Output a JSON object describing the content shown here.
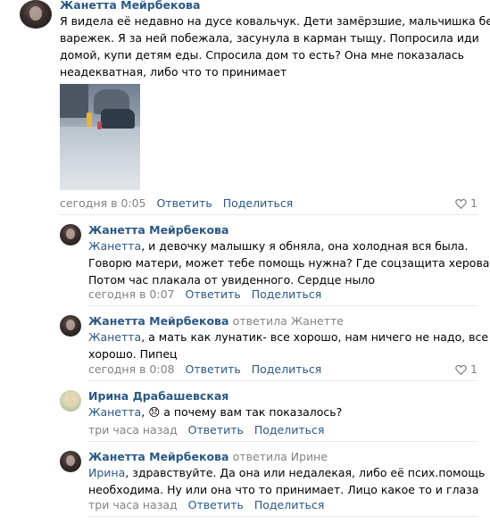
{
  "actions": {
    "reply": "Ответить",
    "share": "Поделиться"
  },
  "comments": [
    {
      "author": "Жанетта Мейрбекова",
      "lines": [
        "Я видела её недавно на дусе ковальчук. Дети замёрзшие, мальчишка без",
        "варежек. Я за ней побежала, засунула в карман тыщу. Попросила иди",
        "домой, купи детям еды. Спросила дом то есть? Она мне показалась",
        "неадекватная, либо что то принимает"
      ],
      "time": "сегодня в 0:05",
      "likes": "1"
    },
    {
      "author": "Жанетта Мейрбекова",
      "mention": "Жанетта",
      "lines": [
        ", и девочку малышку я обняла, она холодная вся была.",
        "Говорю матери, может тебе помощь нужна? Где соцзащита херова?",
        "Потом час плакала от увиденного. Сердце ныло"
      ],
      "time": "сегодня в 0:07"
    },
    {
      "author": "Жанетта Мейрбекова",
      "reply_to": "ответила Жанетте",
      "mention": "Жанетта",
      "lines": [
        ", а мать как лунатик- все хорошо, нам ничего не надо, все",
        "хорошо. Пипец"
      ],
      "time": "сегодня в 0:08",
      "likes": "1"
    },
    {
      "author": "Ирина Драбашевская",
      "mention": "Жанетта",
      "emoji": "😞",
      "lines": [
        ",",
        " а почему вам так показалось?"
      ],
      "time": "три часа назад"
    },
    {
      "author": "Жанетта Мейрбекова",
      "reply_to": "ответила Ирине",
      "mention": "Ирина",
      "lines": [
        ", здравствуйте. Да она или недалекая, либо её псих.помощь",
        "необходима. Ну или она что то принимает. Лицо какое то и глаза"
      ],
      "time": "три часа назад"
    }
  ]
}
